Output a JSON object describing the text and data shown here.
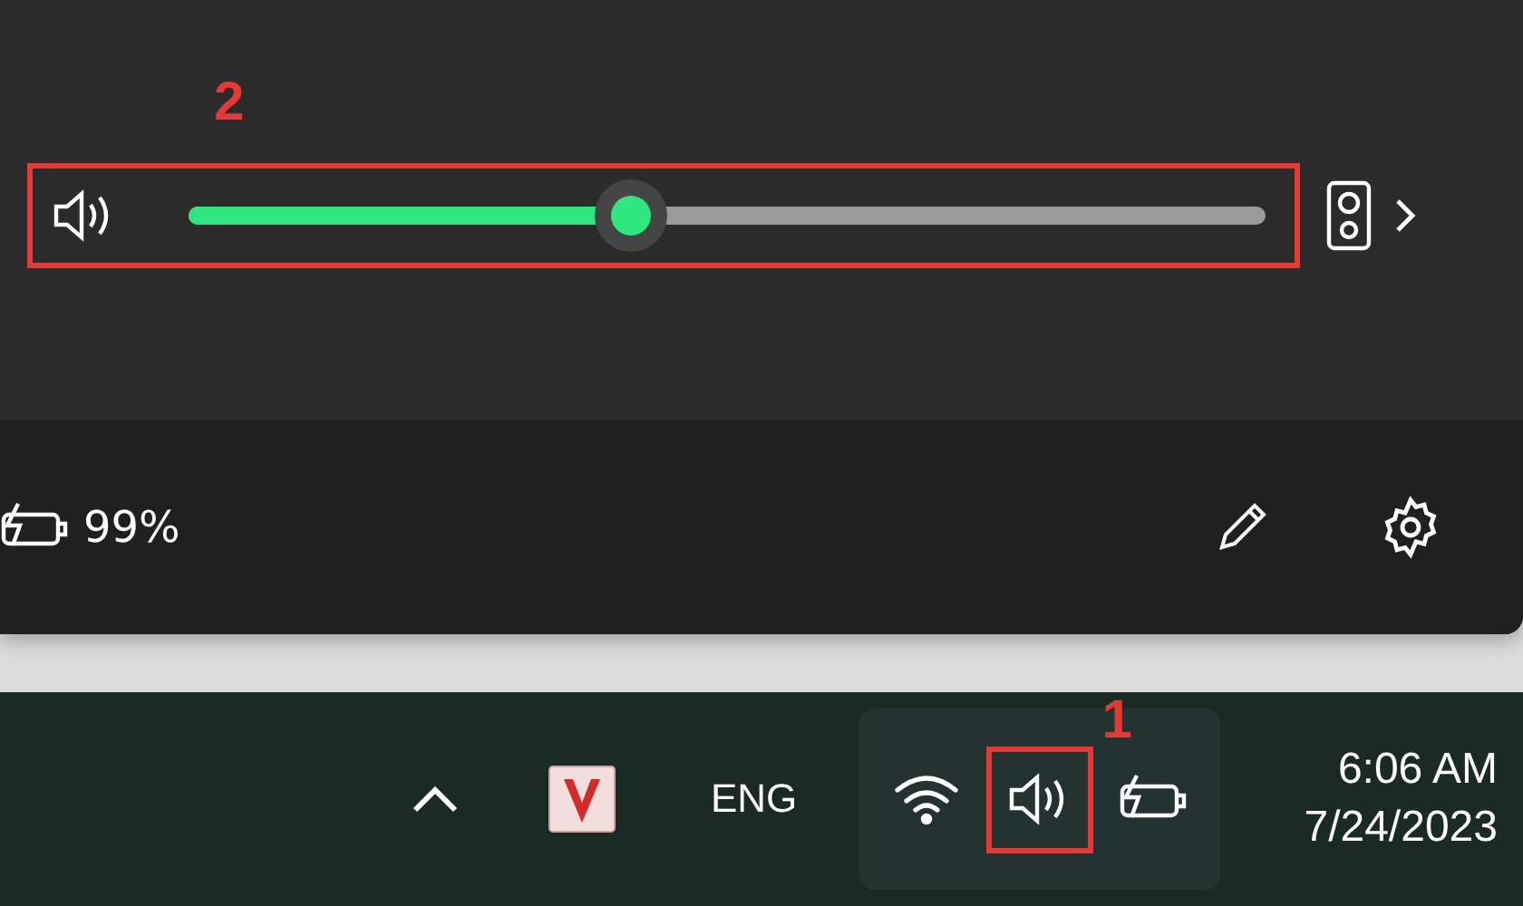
{
  "volume": {
    "level": 0.41,
    "annotation": "2"
  },
  "footer": {
    "battery": "99%"
  },
  "taskbar": {
    "language": "ENG",
    "annotation": "1",
    "time": "6:06 AM",
    "date": "7/24/2023"
  }
}
